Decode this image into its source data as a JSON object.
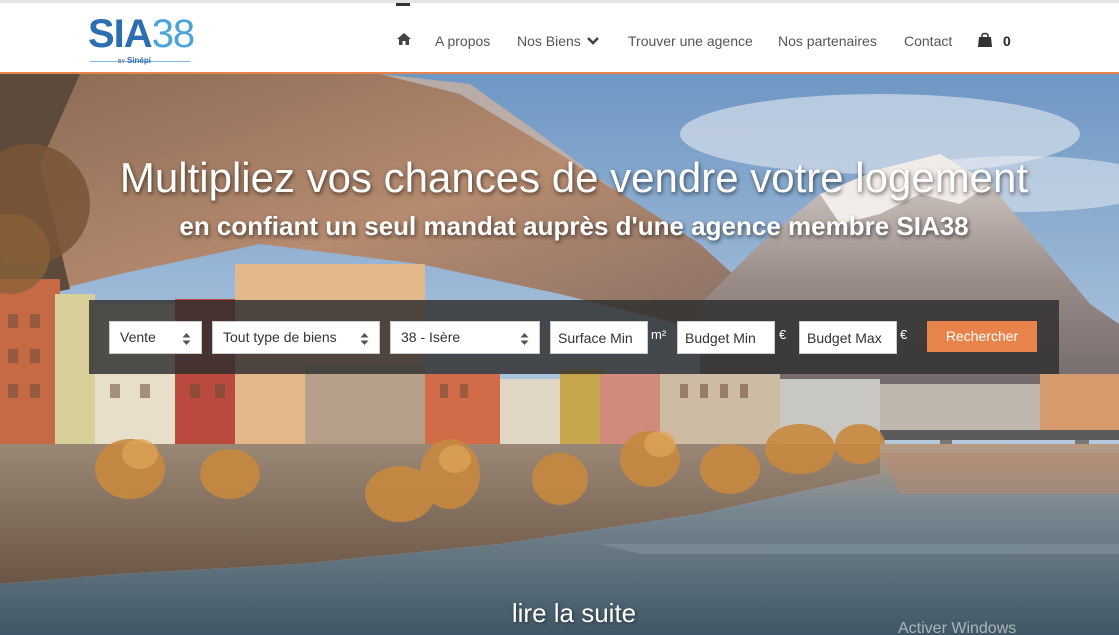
{
  "header": {
    "logo": {
      "primary": "SIA",
      "secondary": "38",
      "by": "BY",
      "partner": "Sinépi"
    },
    "nav": {
      "about": "A propos",
      "properties": "Nos Biens",
      "find_agency": "Trouver une agence",
      "partners": "Nos partenaires",
      "contact": "Contact"
    },
    "cart_count": "0"
  },
  "hero": {
    "headline": "Multipliez vos chances de vendre votre logement",
    "subheadline": "en confiant un seul mandat auprès d'une agence membre SIA38",
    "read_more": "lire la suite"
  },
  "search": {
    "transaction": "Vente",
    "property_type": "Tout type de biens",
    "location": "38 - Isère",
    "surface_min": "Surface Min",
    "surface_unit": "m²",
    "budget_min": "Budget Min",
    "budget_min_unit": "€",
    "budget_max": "Budget Max",
    "budget_max_unit": "€",
    "submit": "Rechercher"
  },
  "system": {
    "watermark": "Activer Windows"
  },
  "colors": {
    "accent": "#e8834b",
    "logo_blue": "#2c6fb1",
    "logo_light_blue": "#4aa3d9"
  }
}
